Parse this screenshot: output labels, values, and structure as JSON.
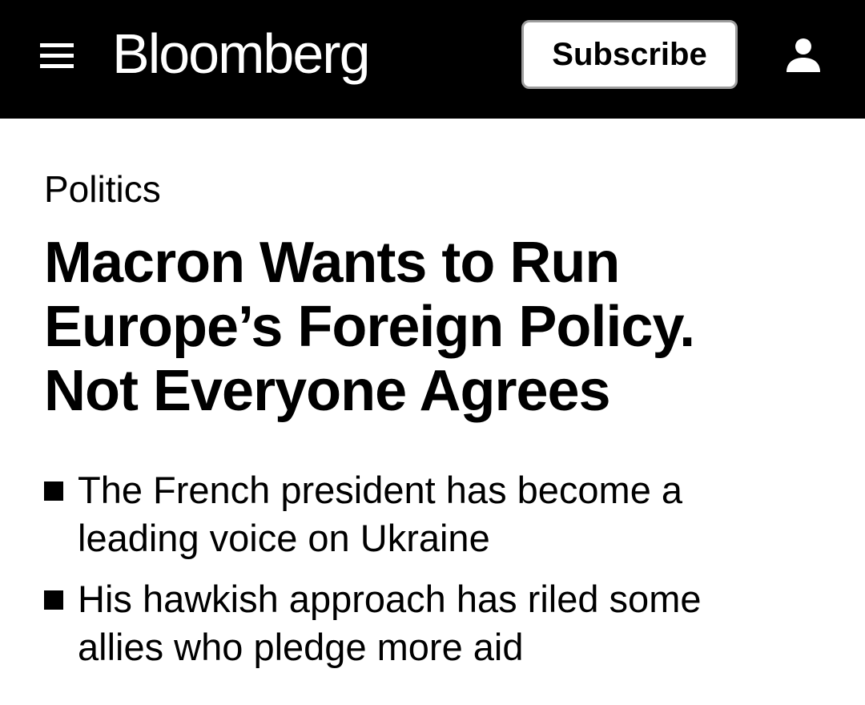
{
  "header": {
    "brand": "Bloomberg",
    "subscribe_label": "Subscribe",
    "menu_icon": "hamburger-menu-icon",
    "account_icon": "user-account-icon",
    "background": "#000000",
    "foreground": "#ffffff"
  },
  "article": {
    "section": "Politics",
    "headline": "Macron Wants to Run Europe’s Foreign Policy. Not Everyone Agrees",
    "bullets": [
      {
        "text": "The French president has become a leading voice on Ukraine"
      },
      {
        "text": "His hawkish approach has riled some allies who pledge more aid"
      }
    ]
  }
}
